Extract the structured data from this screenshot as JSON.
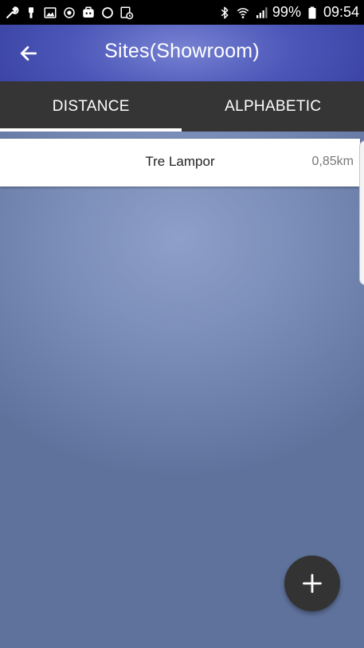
{
  "status_bar": {
    "left_icons": [
      "wrench-icon",
      "usb-icon",
      "image-icon",
      "target-icon",
      "briefcase-icon",
      "circle-icon",
      "calendar-clock-icon"
    ],
    "right_icons": [
      "bluetooth-icon",
      "wifi-icon",
      "signal-icon",
      "battery-icon"
    ],
    "battery": "99%",
    "time": "09:54"
  },
  "header": {
    "title": "Sites(Showroom)",
    "back_icon": "arrow-left-icon"
  },
  "tabs": [
    {
      "label": "DISTANCE",
      "selected": true
    },
    {
      "label": "ALPHABETIC",
      "selected": false
    }
  ],
  "sites": [
    {
      "name": "Tre Lampor",
      "distance": "0,85km"
    }
  ],
  "fab": {
    "icon": "plus-icon"
  }
}
